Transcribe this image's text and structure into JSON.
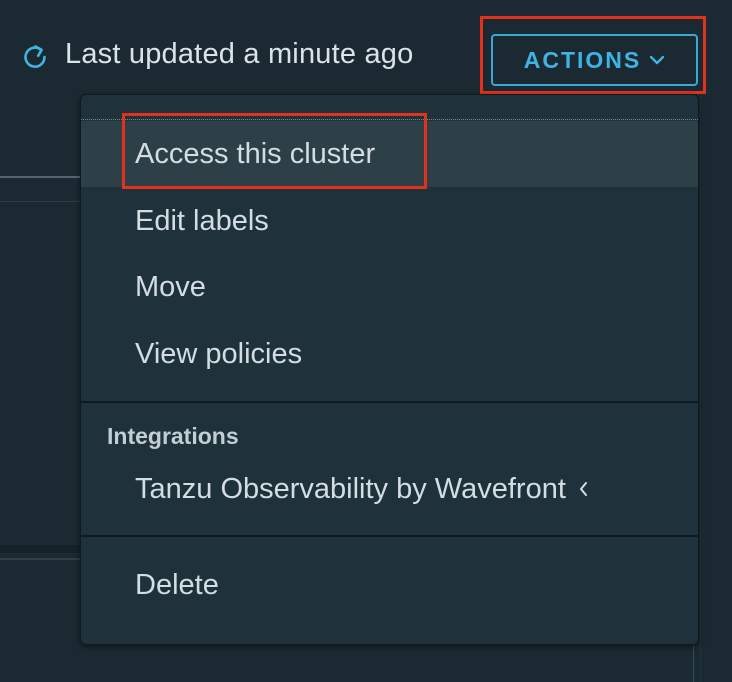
{
  "header": {
    "refresh_icon": "refresh-icon",
    "last_updated": "Last updated a minute ago",
    "actions_label": "ACTIONS",
    "actions_chevron_icon": "chevron-down-icon"
  },
  "menu": {
    "items": [
      {
        "label": "Access this cluster",
        "active": true
      },
      {
        "label": "Edit labels"
      },
      {
        "label": "Move"
      },
      {
        "label": "View policies"
      }
    ],
    "integrations": {
      "header": "Integrations",
      "items": [
        {
          "label": "Tanzu Observability by Wavefront",
          "icon": "chevron-left-icon"
        }
      ]
    },
    "danger": {
      "items": [
        {
          "label": "Delete"
        }
      ]
    }
  },
  "colors": {
    "background": "#1b2a32",
    "menu_background": "#1f313a",
    "menu_active": "#2d4048",
    "accent_blue": "#3fb3e4",
    "highlight_red": "#e1321d",
    "text": "#d3dde2"
  }
}
